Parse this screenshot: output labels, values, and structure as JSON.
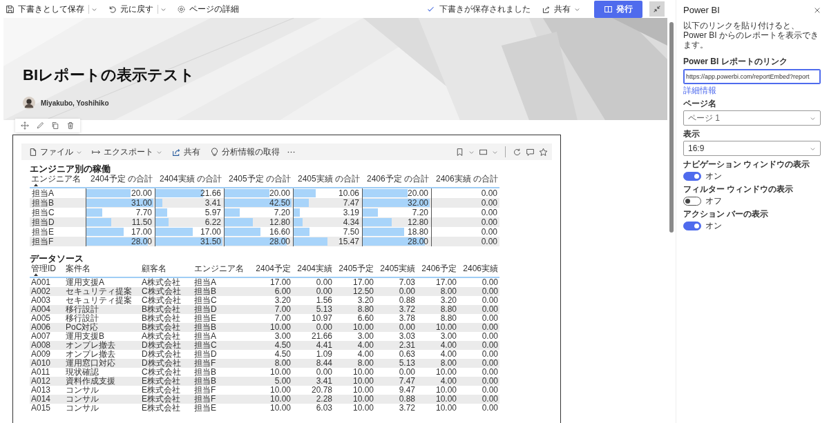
{
  "command_bar": {
    "left": [
      {
        "label": "下書きとして保存",
        "kind": "save",
        "has_menu": true
      },
      {
        "label": "元に戻す",
        "kind": "undo",
        "has_menu": true
      },
      {
        "label": "ページの詳細",
        "kind": "settings",
        "has_menu": false
      }
    ],
    "status": "下書きが保存されました",
    "share": {
      "label": "共有",
      "has_menu": true
    },
    "publish": "発行"
  },
  "hero": {
    "title": "BIレポートの表示テスト",
    "author": "Miyakubo, Yoshihiko"
  },
  "report": {
    "toolbar": [
      {
        "label": "ファイル",
        "kind": "file",
        "has_menu": true
      },
      {
        "label": "エクスポート",
        "kind": "export",
        "has_menu": true
      },
      {
        "label": "共有",
        "kind": "share",
        "has_menu": false
      },
      {
        "label": "分析情報の取得",
        "kind": "insights",
        "has_menu": false
      }
    ],
    "visual_1": {
      "title": "エンジニア別の稼働",
      "columns": [
        {
          "label": "エンジニア名",
          "sorted": true
        },
        {
          "label": "2404予定 の合計",
          "sorted": false
        },
        {
          "label": "2404実績 の合計",
          "sorted": false
        },
        {
          "label": "2405予定 の合計",
          "sorted": false
        },
        {
          "label": "2405実績 の合計",
          "sorted": false
        },
        {
          "label": "2406予定 の合計",
          "sorted": false
        },
        {
          "label": "2406実績 の合計",
          "sorted": false
        }
      ],
      "rows": [
        {
          "cells": [
            {
              "text": "担当A"
            },
            {
              "text": "20.00",
              "level": 0.66
            },
            {
              "text": "21.66",
              "level": 0.71
            },
            {
              "text": "20.00",
              "level": 0.67
            },
            {
              "text": "10.06",
              "level": 0.33
            },
            {
              "text": "20.00",
              "level": 0.67
            },
            {
              "text": "0.00"
            }
          ]
        },
        {
          "cells": [
            {
              "text": "担当B"
            },
            {
              "text": "31.00",
              "level": 1
            },
            {
              "text": "3.41",
              "level": 0.1
            },
            {
              "text": "42.50",
              "level": 1
            },
            {
              "text": "7.47",
              "level": 0.23
            },
            {
              "text": "32.00",
              "level": 1
            },
            {
              "text": "0.00"
            }
          ]
        },
        {
          "cells": [
            {
              "text": "担当C"
            },
            {
              "text": "7.70",
              "level": 0.24
            },
            {
              "text": "5.97",
              "level": 0.18
            },
            {
              "text": "7.20",
              "level": 0.23
            },
            {
              "text": "3.19",
              "level": 0.09
            },
            {
              "text": "7.20",
              "level": 0.23
            },
            {
              "text": "0.00"
            }
          ]
        },
        {
          "cells": [
            {
              "text": "担当D"
            },
            {
              "text": "11.50",
              "level": 0.37
            },
            {
              "text": "6.22",
              "level": 0.2
            },
            {
              "text": "12.80",
              "level": 0.42
            },
            {
              "text": "4.34",
              "level": 0.13
            },
            {
              "text": "12.80",
              "level": 0.43
            },
            {
              "text": "0.00"
            }
          ]
        },
        {
          "cells": [
            {
              "text": "担当E"
            },
            {
              "text": "17.00",
              "level": 0.56
            },
            {
              "text": "17.00",
              "level": 0.56
            },
            {
              "text": "16.60",
              "level": 0.54
            },
            {
              "text": "7.50",
              "level": 0.24
            },
            {
              "text": "18.80",
              "level": 0.62
            },
            {
              "text": "0.00"
            }
          ]
        },
        {
          "cells": [
            {
              "text": "担当F"
            },
            {
              "text": "28.00",
              "level": 0.92
            },
            {
              "text": "31.50",
              "level": 1
            },
            {
              "text": "28.00",
              "level": 0.93
            },
            {
              "text": "15.47",
              "level": 0.51
            },
            {
              "text": "28.00",
              "level": 0.93
            },
            {
              "text": "0.00"
            }
          ]
        }
      ]
    },
    "visual_2": {
      "title": "データソース",
      "columns": [
        {
          "label": "管理ID",
          "sorted": true
        },
        {
          "label": "案件名",
          "sorted": false
        },
        {
          "label": "顧客名",
          "sorted": false
        },
        {
          "label": "エンジニア名",
          "sorted": false
        },
        {
          "label": "2404予定",
          "sorted": false
        },
        {
          "label": "2404実績",
          "sorted": false
        },
        {
          "label": "2405予定",
          "sorted": false
        },
        {
          "label": "2405実績",
          "sorted": false
        },
        {
          "label": "2406予定",
          "sorted": false
        },
        {
          "label": "2406実績",
          "sorted": false
        }
      ],
      "rows": [
        [
          "A001",
          "運用支援A",
          "A株式会社",
          "担当A",
          "17.00",
          "0.00",
          "17.00",
          "7.03",
          "17.00",
          "0.00"
        ],
        [
          "A002",
          "セキュリティ提案",
          "C株式会社",
          "担当B",
          "6.00",
          "0.00",
          "12.50",
          "0.00",
          "8.00",
          "0.00"
        ],
        [
          "A003",
          "セキュリティ提案",
          "C株式会社",
          "担当C",
          "3.20",
          "1.56",
          "3.20",
          "0.88",
          "3.20",
          "0.00"
        ],
        [
          "A004",
          "移行設計",
          "B株式会社",
          "担当D",
          "7.00",
          "5.13",
          "8.80",
          "3.72",
          "8.80",
          "0.00"
        ],
        [
          "A005",
          "移行設計",
          "B株式会社",
          "担当E",
          "7.00",
          "10.97",
          "6.60",
          "3.78",
          "8.80",
          "0.00"
        ],
        [
          "A006",
          "PoC対応",
          "B株式会社",
          "担当B",
          "10.00",
          "0.00",
          "10.00",
          "0.00",
          "10.00",
          "0.00"
        ],
        [
          "A007",
          "運用支援B",
          "A株式会社",
          "担当A",
          "3.00",
          "21.66",
          "3.00",
          "3.03",
          "3.00",
          "0.00"
        ],
        [
          "A008",
          "オンプレ撤去",
          "D株式会社",
          "担当C",
          "4.50",
          "4.41",
          "4.00",
          "2.31",
          "4.00",
          "0.00"
        ],
        [
          "A009",
          "オンプレ撤去",
          "D株式会社",
          "担当D",
          "4.50",
          "1.09",
          "4.00",
          "0.63",
          "4.00",
          "0.00"
        ],
        [
          "A010",
          "運用窓口対応",
          "D株式会社",
          "担当F",
          "8.00",
          "8.44",
          "8.00",
          "5.13",
          "8.00",
          "0.00"
        ],
        [
          "A011",
          "現状確認",
          "C株式会社",
          "担当B",
          "10.00",
          "0.00",
          "10.00",
          "0.00",
          "10.00",
          "0.00"
        ],
        [
          "A012",
          "資料作成支援",
          "E株式会社",
          "担当B",
          "5.00",
          "3.41",
          "10.00",
          "7.47",
          "4.00",
          "0.00"
        ],
        [
          "A013",
          "コンサル",
          "E株式会社",
          "担当F",
          "10.00",
          "20.78",
          "10.00",
          "9.47",
          "10.00",
          "0.00"
        ],
        [
          "A014",
          "コンサル",
          "E株式会社",
          "担当F",
          "10.00",
          "2.28",
          "10.00",
          "0.88",
          "10.00",
          "0.00"
        ],
        [
          "A015",
          "コンサル",
          "E株式会社",
          "担当E",
          "10.00",
          "6.03",
          "10.00",
          "3.72",
          "10.00",
          "0.00"
        ]
      ]
    }
  },
  "panel": {
    "title": "Power BI",
    "description": "以下のリンクを貼り付けると、Power BI からのレポートを表示できます。",
    "link_field": {
      "label": "Power BI レポートのリンク",
      "value": "https://app.powerbi.com/reportEmbed?report"
    },
    "more_info": "詳細情報",
    "page_name": {
      "label": "ページ名",
      "value": "ページ 1"
    },
    "display": {
      "label": "表示",
      "value": "16:9"
    },
    "toggles": [
      {
        "label": "ナビゲーション ウィンドウの表示",
        "on": true,
        "state_text": "オン"
      },
      {
        "label": "フィルター ウィンドウの表示",
        "on": false,
        "state_text": "オフ"
      },
      {
        "label": "アクション バーの表示",
        "on": true,
        "state_text": "オン"
      }
    ]
  }
}
